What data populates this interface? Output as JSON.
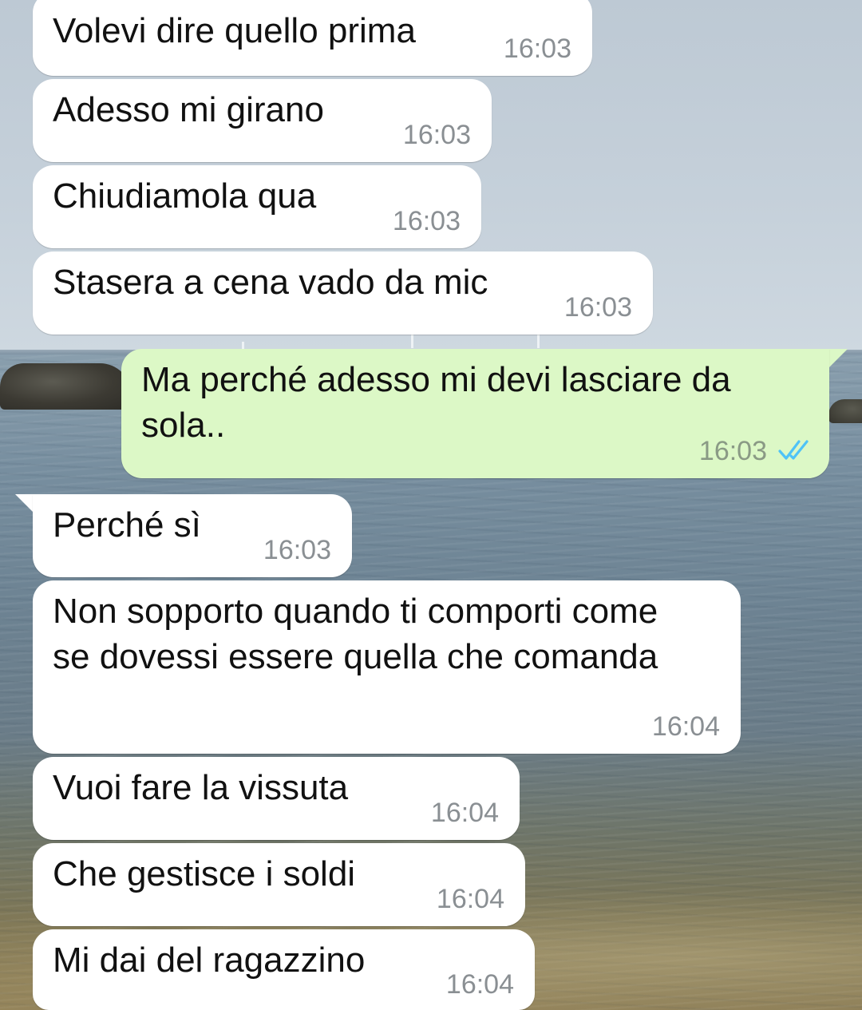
{
  "chat": {
    "messages": [
      {
        "direction": "in",
        "text": "Volevi dire quello prima",
        "time": "16:03"
      },
      {
        "direction": "in",
        "text": "Adesso mi girano",
        "time": "16:03"
      },
      {
        "direction": "in",
        "text": "Chiudiamola qua",
        "time": "16:03"
      },
      {
        "direction": "in",
        "text": "Stasera a cena vado da mic",
        "time": "16:03"
      },
      {
        "direction": "out",
        "text": "Ma perché adesso mi devi lasciare da sola..",
        "time": "16:03",
        "status_icon": "double-check-read-icon"
      },
      {
        "direction": "in",
        "text": "Perché sì",
        "time": "16:03"
      },
      {
        "direction": "in",
        "text": "Non sopporto quando ti comporti come se dovessi essere quella che comanda",
        "time": "16:04"
      },
      {
        "direction": "in",
        "text": "Vuoi fare la vissuta",
        "time": "16:04"
      },
      {
        "direction": "in",
        "text": "Che gestisce i soldi",
        "time": "16:04"
      },
      {
        "direction": "in",
        "text": "Mi dai del ragazzino",
        "time": "16:04"
      }
    ]
  },
  "theme": {
    "incoming_bubble": "#ffffff",
    "outgoing_bubble": "#dcf8c6",
    "read_tick_color": "#4fc3f7",
    "timestamp_color": "#8a8f93"
  }
}
